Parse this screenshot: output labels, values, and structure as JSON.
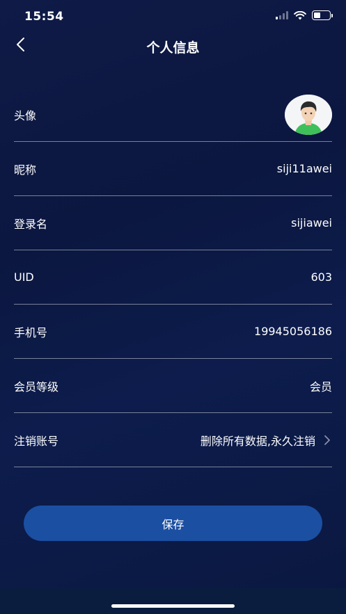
{
  "status_bar": {
    "time": "15:54",
    "signal_icon": "cellular-signal-icon",
    "wifi_icon": "wifi-icon",
    "battery_icon": "battery-icon",
    "battery_level": 0.45
  },
  "nav": {
    "back_icon": "chevron-left-icon",
    "title": "个人信息"
  },
  "profile": {
    "avatar": {
      "label": "头像",
      "icon": "avatar-person-icon"
    },
    "nickname": {
      "label": "昵称",
      "value": "siji11awei"
    },
    "login_name": {
      "label": "登录名",
      "value": "sijiawei"
    },
    "uid": {
      "label": "UID",
      "value": "603"
    },
    "phone": {
      "label": "手机号",
      "value": "19945056186"
    },
    "member_level": {
      "label": "会员等级",
      "value": "会员"
    },
    "cancel_account": {
      "label": "注销账号",
      "value": "删除所有数据,永久注销",
      "icon": "chevron-right-icon"
    }
  },
  "actions": {
    "save_label": "保存"
  },
  "colors": {
    "background": "#0d1a47",
    "button": "#1b4fa2",
    "divider": "#8088a3",
    "bottom_bar": "#0a1d3f"
  }
}
